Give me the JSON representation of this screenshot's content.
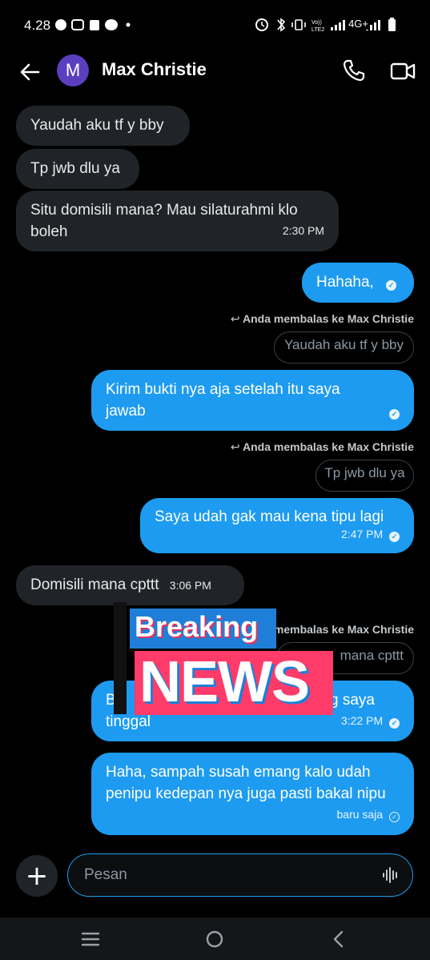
{
  "status_bar": {
    "time": "4.28",
    "left_icons": [
      "chat-bubble-icon",
      "photos-icon",
      "store-icon",
      "message-icon",
      "dot-icon"
    ],
    "network_label": "4G+",
    "volte_label": "Vo) LTE2"
  },
  "header": {
    "avatar_letter": "M",
    "contact_name": "Max Christie",
    "accent_color": "#5b3fbf"
  },
  "messages": {
    "m1": {
      "text": "Yaudah aku tf y bby"
    },
    "m2": {
      "text": "Tp jwb dlu ya"
    },
    "m3": {
      "text": "Situ domisili mana? Mau silaturahmi klo boleh",
      "time": "2:30 PM"
    },
    "m4": {
      "text": "Hahaha,"
    },
    "r1": {
      "note": "Anda membalas ke Max Christie",
      "quote": "Yaudah aku tf y bby"
    },
    "m5": {
      "text": "Kirim bukti nya aja setelah itu saya jawab"
    },
    "r2": {
      "note": "Anda membalas ke Max Christie",
      "quote": "Tp jwb dlu ya"
    },
    "m6": {
      "text": "Saya udah gak mau kena tipu lagi",
      "time": "2:47 PM"
    },
    "m7": {
      "text": "Domisili mana cpttt",
      "time": "3:06 PM"
    },
    "r3": {
      "note": "membalas ke Max Christie",
      "quote": "mana cpttt"
    },
    "m8": {
      "text_left": "B",
      "text_right": "g saya",
      "text_line2": "tinggal",
      "time": "3:22 PM"
    },
    "m9": {
      "text": "Haha, sampah susah emang kalo udah penipu kedepan nya juga pasti bakal nipu",
      "time": "baru saja"
    }
  },
  "overlay": {
    "line1": "Breaking",
    "line2": "NEWS"
  },
  "composer": {
    "placeholder": "Pesan"
  },
  "colors": {
    "background": "#000000",
    "incoming_bubble": "#202327",
    "outgoing_bubble": "#1d9bf0",
    "overlay_blue": "#1f7fd8",
    "overlay_pink": "#ff3b6a"
  }
}
